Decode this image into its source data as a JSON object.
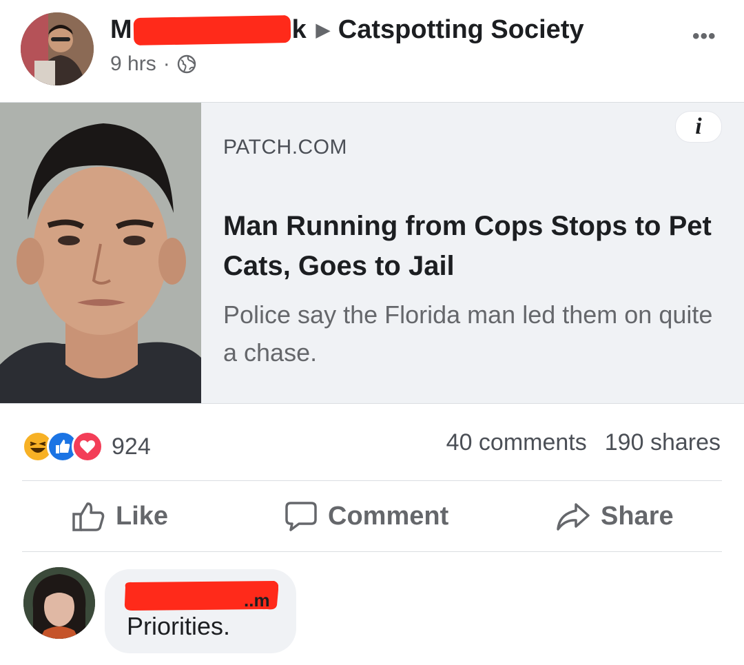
{
  "post": {
    "author_initial": "M",
    "author_final": "k",
    "arrow": "▶",
    "group": "Catspotting Society",
    "time": "9 hrs",
    "dot": "·",
    "more": "•••"
  },
  "link_card": {
    "info": "i",
    "source": "PATCH.COM",
    "headline": "Man Running from Cops Stops to Pet Cats, Goes to Jail",
    "description": "Police say the Florida man led them on quite a chase."
  },
  "stats": {
    "reaction_count": "924",
    "comments": "40 comments",
    "shares": "190 shares"
  },
  "actions": {
    "like": "Like",
    "comment": "Comment",
    "share": "Share"
  },
  "comment": {
    "author_suffix": "..m",
    "text": "Priorities."
  },
  "colors": {
    "redaction": "#ff2a1a",
    "secondary_text": "#65676b",
    "card_bg": "#f0f2f5"
  }
}
